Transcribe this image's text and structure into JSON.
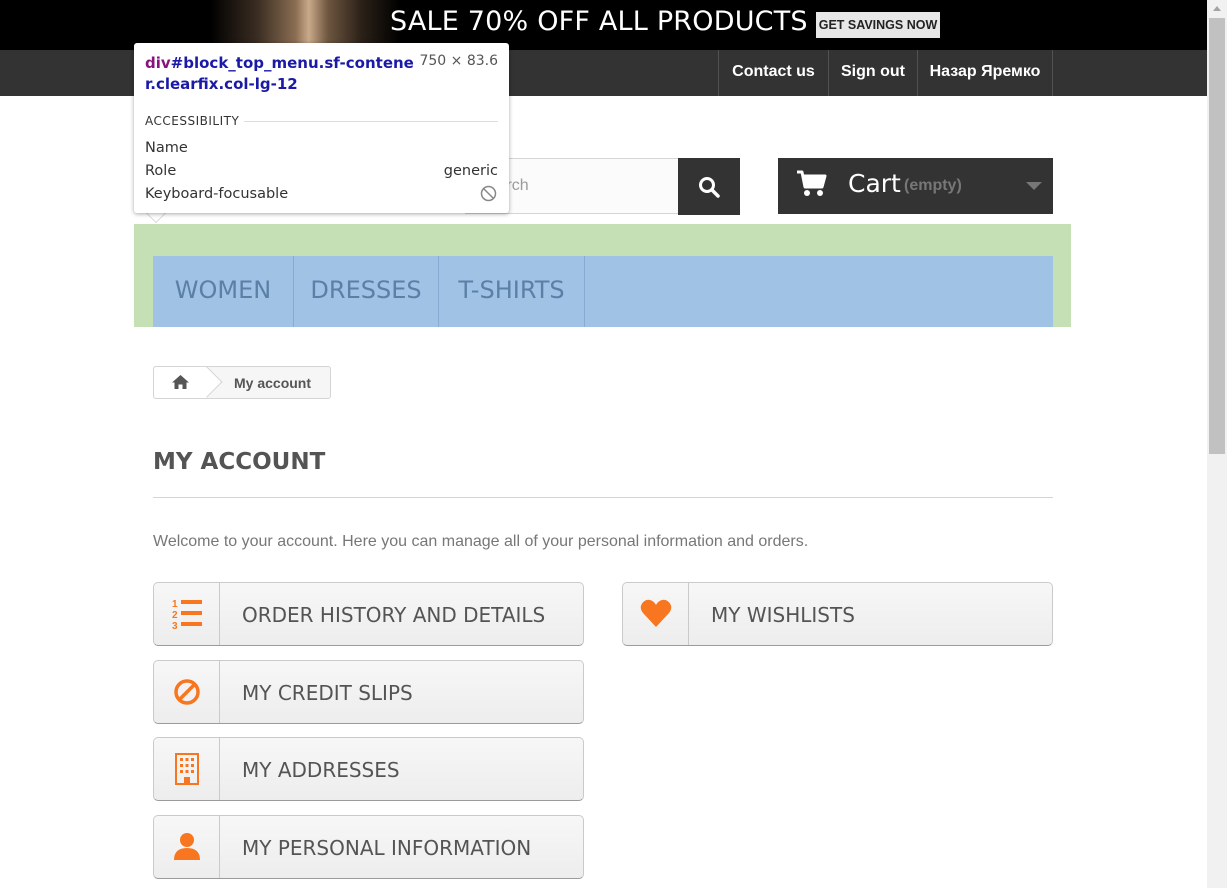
{
  "banner": {
    "headline": "SALE 70% OFF ALL PRODUCTS",
    "button_label": "GET SAVINGS NOW"
  },
  "nav": {
    "contact_label": "Contact us",
    "signout_label": "Sign out",
    "user_name": "Назар Яремко"
  },
  "search": {
    "placeholder": "Search"
  },
  "cart": {
    "label": "Cart",
    "status": "(empty)"
  },
  "menu": {
    "items": [
      {
        "label": "WOMEN"
      },
      {
        "label": "DRESSES"
      },
      {
        "label": "T-SHIRTS"
      }
    ]
  },
  "breadcrumb": {
    "current": "My account"
  },
  "page": {
    "title": "MY ACCOUNT",
    "welcome": "Welcome to your account. Here you can manage all of your personal information and orders."
  },
  "tiles": {
    "orders": {
      "label": "ORDER HISTORY AND DETAILS",
      "icon": "ordered-list-icon"
    },
    "credit": {
      "label": "MY CREDIT SLIPS",
      "icon": "ban-icon"
    },
    "addresses": {
      "label": "MY ADDRESSES",
      "icon": "building-icon"
    },
    "personal": {
      "label": "MY PERSONAL INFORMATION",
      "icon": "user-icon"
    },
    "wishlists": {
      "label": "MY WISHLISTS",
      "icon": "heart-icon"
    }
  },
  "tooltip": {
    "tag": "div",
    "selector": "#block_top_menu.sf-contener.clearfix.col-lg-12",
    "size": "750 × 83.6",
    "section": "ACCESSIBILITY",
    "rows": [
      {
        "label": "Name",
        "value": ""
      },
      {
        "label": "Role",
        "value": "generic"
      },
      {
        "label": "Keyboard-focusable",
        "value": ""
      }
    ]
  },
  "colors": {
    "accent": "#f7761f",
    "dark": "#333333",
    "menu_highlight": "#9fc2e5",
    "margin_highlight": "#c5e0b4"
  }
}
